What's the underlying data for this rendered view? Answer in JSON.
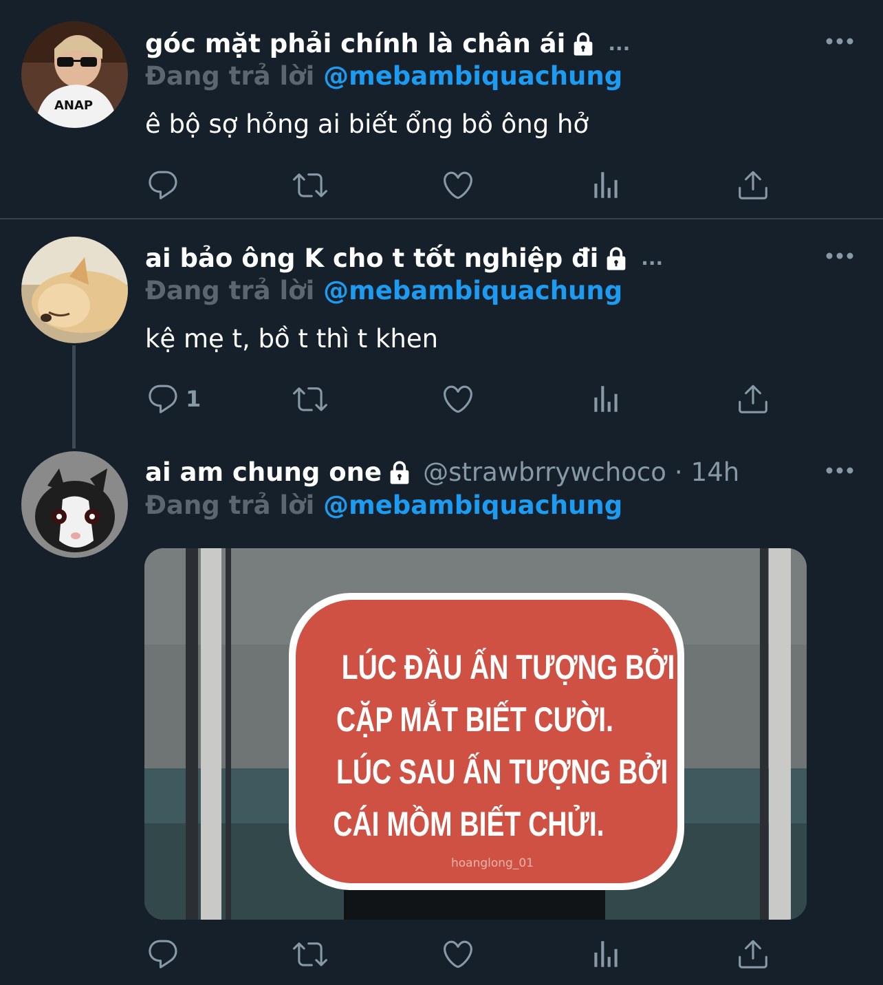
{
  "tweets": [
    {
      "display_name": "góc mặt phải chính là chân ái",
      "ellipsis": "...",
      "replying_label": "Đang trả lời",
      "replying_to": "@mebambiquachung",
      "text": "ê bộ sợ hỏng ai biết ổng bồ ông hở",
      "reply_count": ""
    },
    {
      "display_name": "ai bảo ông K cho t tốt nghiệp đi",
      "ellipsis": "...",
      "replying_label": "Đang trả lời",
      "replying_to": "@mebambiquachung",
      "text": "kệ mẹ t, bồ t thì t khen",
      "reply_count": "1"
    },
    {
      "display_name": "ai am chung one",
      "handle": "@strawbrrywchoco",
      "separator": "·",
      "time": "14h",
      "replying_label": "Đang trả lời",
      "replying_to": "@mebambiquachung",
      "reply_count": "",
      "media": {
        "sign_lines": [
          "LÚC ĐẦU ẤN TƯỢNG BỞI",
          "CẶP MẮT BIẾT CƯỜI.",
          "LÚC SAU ẤN TƯỢNG BỞI",
          "CÁI MỒM BIẾT CHỬI."
        ],
        "watermark": "hoanglong_01"
      }
    }
  ],
  "icons": {
    "reply": "reply-icon",
    "retweet": "retweet-icon",
    "like": "heart-icon",
    "analytics": "analytics-icon",
    "share": "share-icon",
    "lock": "lock-icon",
    "more": "more-icon"
  },
  "colors": {
    "background": "#15202b",
    "mention": "#1d9bf0",
    "muted": "#8899a6",
    "replying_label": "#5b6670",
    "sign_red": "#cf5143"
  }
}
